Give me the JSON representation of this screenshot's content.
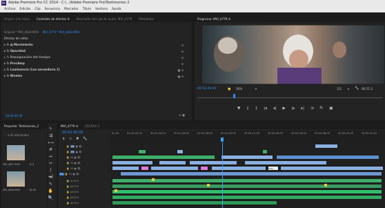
{
  "app": {
    "title": "Adobe Premiere Pro CC 2014 - C:\\...\\Adobe Premiere Pro\\Testimonios 2",
    "icon_label": "Pr"
  },
  "menu": [
    "Archivo",
    "Edición",
    "Clip",
    "Secuencia",
    "Marcador",
    "Título",
    "Ventana",
    "Ayuda"
  ],
  "source_panel": {
    "tabs": [
      "Origen: (sin clips)",
      "Controles de efectos ≡",
      "Mezclador del clip de audio: MVI_4779",
      "Metadatos"
    ],
    "breadcrumb_master": "Original * MVI_4834.MOV",
    "breadcrumb_seq": "MVI_4779 * MVI_4834.MOV",
    "section": "Efectos de vídeo",
    "effects": [
      "Movimiento",
      "Opacidad",
      "Reasignación del tiempo",
      "ProcAmp",
      "Luminancia (Luz secundaria 1)",
      "Niveles"
    ],
    "timecode": "00:02:40:00"
  },
  "program": {
    "tab": "Programa: MVI_4779 ≡",
    "timecode": "00:02:40:00",
    "zoom": "50%",
    "quality": "1/2",
    "duration": "00:11:2"
  },
  "project": {
    "tab": "Proyecto: Testimonios_2",
    "items_count": "62 elementos",
    "items": [
      {
        "name": "MVI_4827.MOV",
        "dur": "3:21"
      },
      {
        "name": "MVI_4836.MOV",
        "dur": "16:08"
      }
    ]
  },
  "timeline": {
    "tabs": [
      "MVI_4779 ≡",
      "ESCENA 3"
    ],
    "timecode": "00:02:40:00",
    "ruler": [
      "00:00",
      "00:00:32:00",
      "00:01:04:00",
      "00:01:36:00",
      "00:02:08:00",
      "00:02:40:00",
      "00:03:12:00",
      "00:03:44:00",
      "00:04:16:00",
      "00:04:48:00",
      "00:05:20:00",
      "00:05:52:00"
    ],
    "video_tracks": [
      "V6",
      "V5",
      "V4",
      "V3",
      "V2",
      "V1"
    ],
    "audio_tracks": [
      "A1",
      "A2",
      "A3",
      "A4",
      "A5",
      "A6"
    ],
    "selected_source": "V1",
    "clip_label": "MVI_"
  },
  "colors": {
    "accent_blue": "#2f8df2",
    "playhead": "#3aa0ff",
    "video_clip": "#8bb0e0",
    "audio_clip": "#3fae6a",
    "pink_clip": "#e07ad8"
  }
}
